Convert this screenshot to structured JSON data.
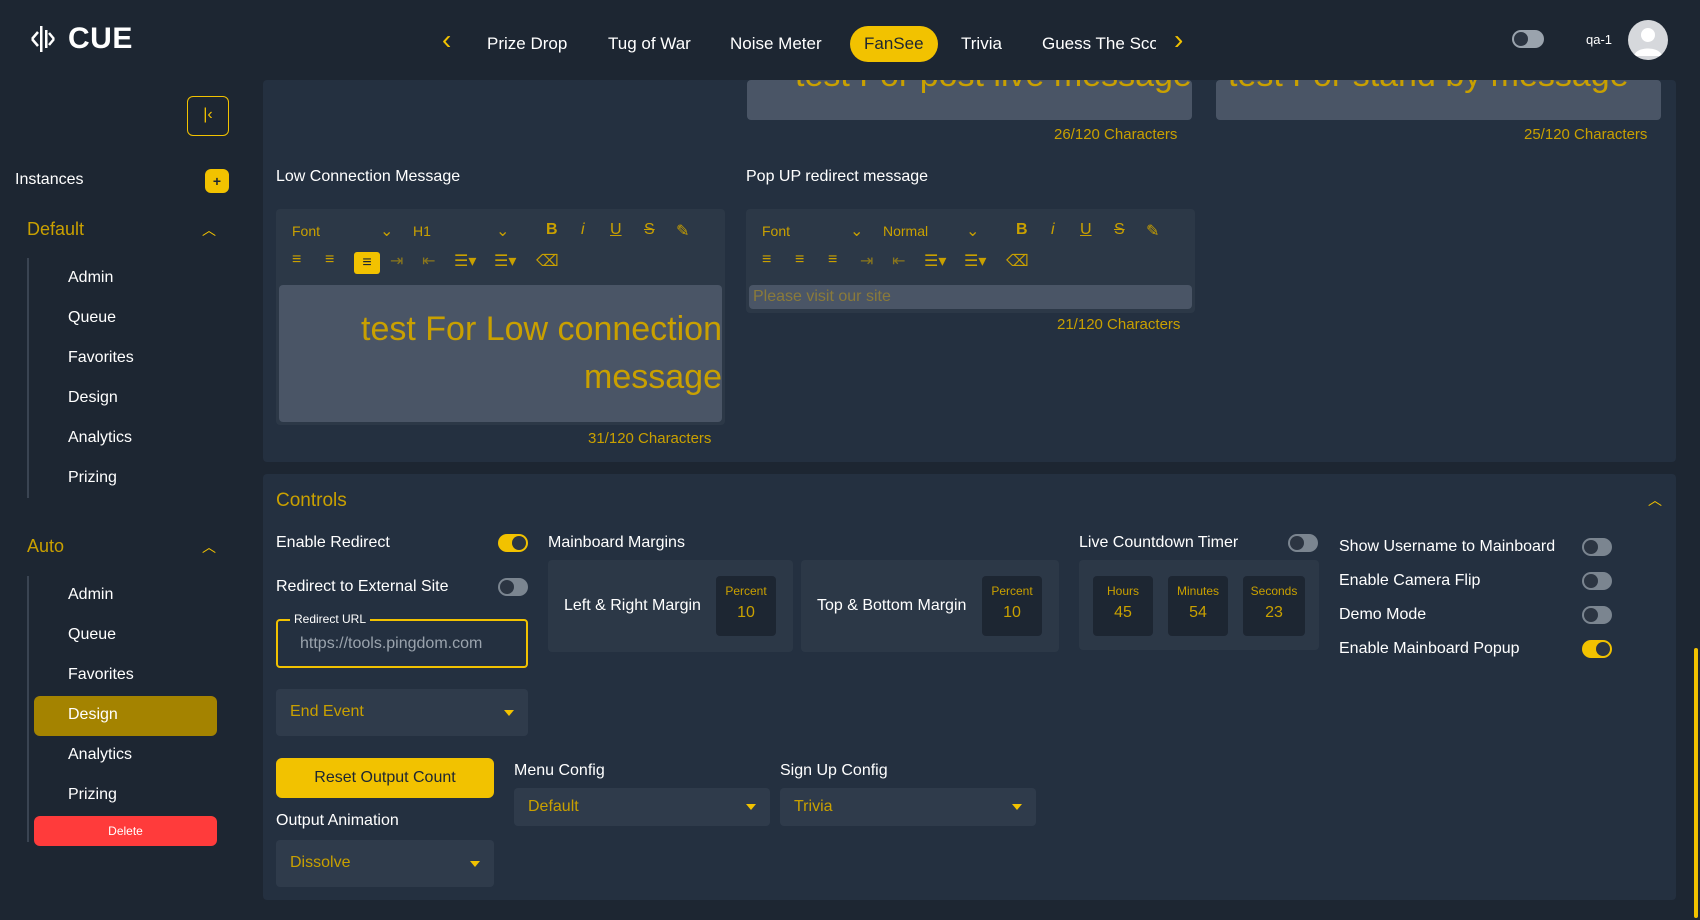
{
  "app": {
    "logo_text": "CUE"
  },
  "nav": {
    "tabs": [
      {
        "label": "Prize Drop"
      },
      {
        "label": "Tug of War"
      },
      {
        "label": "Noise Meter"
      },
      {
        "label": "FanSee"
      },
      {
        "label": "Trivia"
      },
      {
        "label": "Guess The Sco"
      }
    ],
    "active_tab": "FanSee"
  },
  "user": {
    "name": "qa-1"
  },
  "sidebar": {
    "instances_label": "Instances",
    "add_label": "+",
    "groups": [
      {
        "title": "Default",
        "items": [
          "Admin",
          "Queue",
          "Favorites",
          "Design",
          "Analytics",
          "Prizing"
        ]
      },
      {
        "title": "Auto",
        "items": [
          "Admin",
          "Queue",
          "Favorites",
          "Design",
          "Analytics",
          "Prizing"
        ],
        "active_item": "Design"
      }
    ],
    "delete_label": "Delete"
  },
  "messages": {
    "post_live": {
      "preview": "test For post live message",
      "counter": "26/120 Characters"
    },
    "stand_by": {
      "preview": "test For stand by message",
      "counter": "25/120 Characters"
    },
    "low_connection": {
      "label": "Low Connection Message",
      "font": "Font",
      "heading": "H1",
      "text": "test For Low connection message",
      "counter": "31/120 Characters"
    },
    "popup_redirect": {
      "label": "Pop UP redirect message",
      "font": "Font",
      "heading": "Normal",
      "text": "Please visit our site",
      "counter": "21/120 Characters"
    }
  },
  "controls": {
    "title": "Controls",
    "enable_redirect": {
      "label": "Enable Redirect",
      "on": true
    },
    "redirect_external": {
      "label": "Redirect to External Site",
      "on": false
    },
    "redirect_url": {
      "label": "Redirect URL",
      "value": "https://tools.pingdom.com"
    },
    "end_event": {
      "placeholder": "End Event"
    },
    "mainboard_margins": {
      "label": "Mainboard Margins",
      "left_right": {
        "label": "Left & Right Margin",
        "unit": "Percent",
        "value": "10"
      },
      "top_bottom": {
        "label": "Top & Bottom Margin",
        "unit": "Percent",
        "value": "10"
      }
    },
    "live_countdown": {
      "label": "Live Countdown Timer",
      "on": false,
      "hours": {
        "label": "Hours",
        "value": "45"
      },
      "minutes": {
        "label": "Minutes",
        "value": "54"
      },
      "seconds": {
        "label": "Seconds",
        "value": "23"
      }
    },
    "toggles": [
      {
        "label": "Show Username to Mainboard",
        "on": false
      },
      {
        "label": "Enable Camera Flip",
        "on": false
      },
      {
        "label": "Demo Mode",
        "on": false
      },
      {
        "label": "Enable Mainboard Popup",
        "on": true
      }
    ],
    "reset_output_label": "Reset Output Count",
    "output_animation": {
      "label": "Output Animation",
      "value": "Dissolve"
    },
    "menu_config": {
      "label": "Menu Config",
      "value": "Default"
    },
    "signup_config": {
      "label": "Sign Up Config",
      "value": "Trivia"
    }
  },
  "colors": {
    "accent": "#f2c200",
    "background": "#1d2632",
    "panel": "#243040",
    "danger": "#ff3b3b"
  }
}
